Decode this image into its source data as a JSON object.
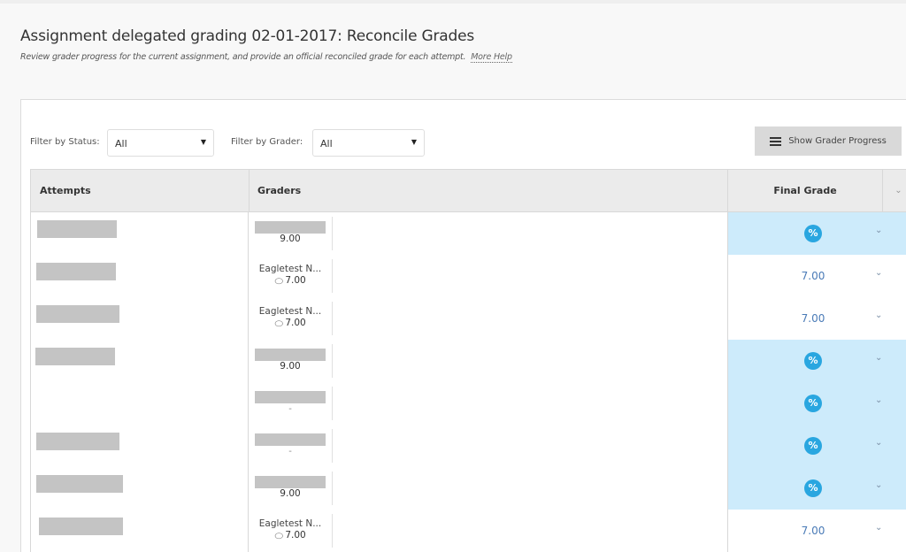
{
  "page": {
    "title": "Assignment delegated grading 02-01-2017: Reconcile Grades",
    "subtitle": "Review grader progress for the current assignment, and provide an official reconciled grade for each attempt.",
    "help_link": "More Help"
  },
  "filters": {
    "status_label": "Filter by Status:",
    "status_value": "All",
    "grader_label": "Filter by Grader:",
    "grader_value": "All",
    "dropdown_arrow": "▼"
  },
  "toolbar": {
    "grader_progress_label": "Show Grader Progress",
    "grader_progress_icon": "list-icon"
  },
  "table": {
    "columns": {
      "attempts": "Attempts",
      "graders": "Graders",
      "final_grade": "Final Grade",
      "menu_icon": "⌄"
    },
    "reconcile_icon_glyph": "%",
    "chevron_glyph": "⌄",
    "comment_glyph": "💬",
    "rows": [
      {
        "attempt_redacted": true,
        "grader_name": "",
        "grader_redacted": true,
        "grader_score": "9.00",
        "has_comment": false,
        "final_grade": "",
        "needs_reconcile": true
      },
      {
        "attempt_redacted": true,
        "grader_name": "Eagletest N...",
        "grader_redacted": false,
        "grader_score": "7.00",
        "has_comment": true,
        "final_grade": "7.00",
        "needs_reconcile": false
      },
      {
        "attempt_redacted": true,
        "grader_name": "Eagletest N...",
        "grader_redacted": false,
        "grader_score": "7.00",
        "has_comment": true,
        "final_grade": "7.00",
        "needs_reconcile": false
      },
      {
        "attempt_redacted": true,
        "grader_name": "",
        "grader_redacted": true,
        "grader_score": "9.00",
        "has_comment": false,
        "final_grade": "",
        "needs_reconcile": true
      },
      {
        "attempt_redacted": false,
        "grader_name": "",
        "grader_redacted": true,
        "grader_score": "-",
        "has_comment": false,
        "final_grade": "",
        "needs_reconcile": true
      },
      {
        "attempt_redacted": true,
        "grader_name": "",
        "grader_redacted": true,
        "grader_score": "-",
        "has_comment": false,
        "final_grade": "",
        "needs_reconcile": true
      },
      {
        "attempt_redacted": true,
        "grader_name": "",
        "grader_redacted": true,
        "grader_score": "9.00",
        "has_comment": false,
        "final_grade": "",
        "needs_reconcile": true
      },
      {
        "attempt_redacted": true,
        "grader_name": "Eagletest N...",
        "grader_redacted": false,
        "grader_score": "7.00",
        "has_comment": true,
        "final_grade": "7.00",
        "needs_reconcile": false
      }
    ]
  },
  "colors": {
    "reconcile_bg": "#cdebfb",
    "reconcile_icon": "#29a6e0",
    "grade_text": "#4a7bb7"
  }
}
